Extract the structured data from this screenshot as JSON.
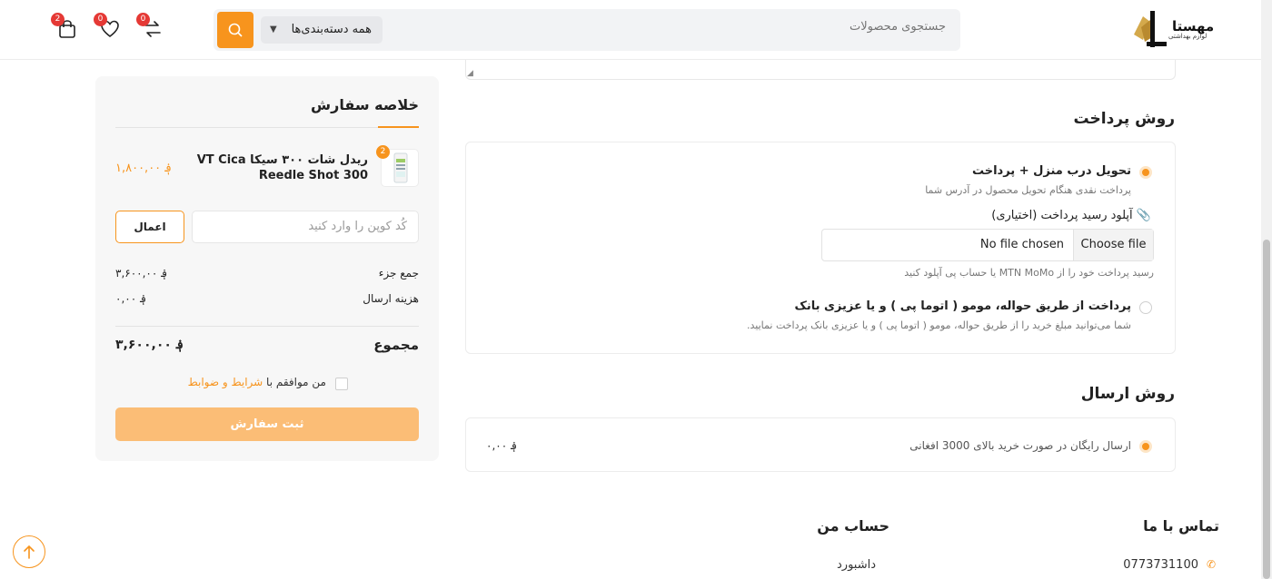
{
  "header": {
    "logo_text": "مهستا",
    "logo_sub": "لوازم بهداشتی",
    "search_placeholder": "جستجوی محصولات",
    "category_select": "همه دسته‌بندی‌ها",
    "cart_count": "2",
    "wishlist_count": "0",
    "compare_count": "0"
  },
  "payment": {
    "title": "روش پرداخت",
    "option1_title": "تحویل درب منزل + پرداخت",
    "option1_desc": "پرداخت نقدی هنگام تحویل محصول در آدرس شما",
    "upload_label": "آپلود رسید پرداخت (اختیاری)",
    "upload_icon": "📎",
    "file_button": "Choose file",
    "file_status": "No file chosen",
    "upload_hint": "رسید پرداخت خود را از MTN MoMo یا حساب پی آپلود کنید",
    "option2_title": "پرداخت از طریق حواله، مومو ( اتوما پی ) و یا عزیزی بانک",
    "option2_desc": "شما می‌توانید مبلغ خرید را از طریق حواله، مومو ( اتوما پی ) و یا عزیزی بانک پرداخت نمایید."
  },
  "shipping": {
    "title": "روش ارسال",
    "option_label": "ارسال رایگان در صورت خرید بالای 3000 افغانی",
    "option_price": "؋ ۰,۰۰"
  },
  "summary": {
    "title": "خلاصه سفارش",
    "product_qty": "2",
    "product_name": "ریدل شات ۳۰۰ سیکا VT Cica Reedle Shot 300",
    "product_price": "؋ ۱,۸۰۰,۰۰",
    "coupon_placeholder": "کُد کوپن را وارد کنید",
    "apply_label": "اعمال",
    "subtotal_label": "جمع جزء",
    "subtotal_value": "؋ ۳,۶۰۰,۰۰",
    "shipping_label": "هزینه ارسال",
    "shipping_value": "؋ ۰,۰۰",
    "total_label": "مجموع",
    "total_value": "؋ ۳,۶۰۰,۰۰",
    "agree_prefix": "من موافقم با",
    "agree_link": "شرایط و ضوابط",
    "submit_label": "ثبت سفارش"
  },
  "footer": {
    "contact_title": "تماس با ما",
    "contact_phone": "0773731100",
    "account_title": "حساب من",
    "account_dashboard": "داشبورد"
  },
  "colors": {
    "accent": "#f7941d",
    "badge": "#e53935"
  }
}
